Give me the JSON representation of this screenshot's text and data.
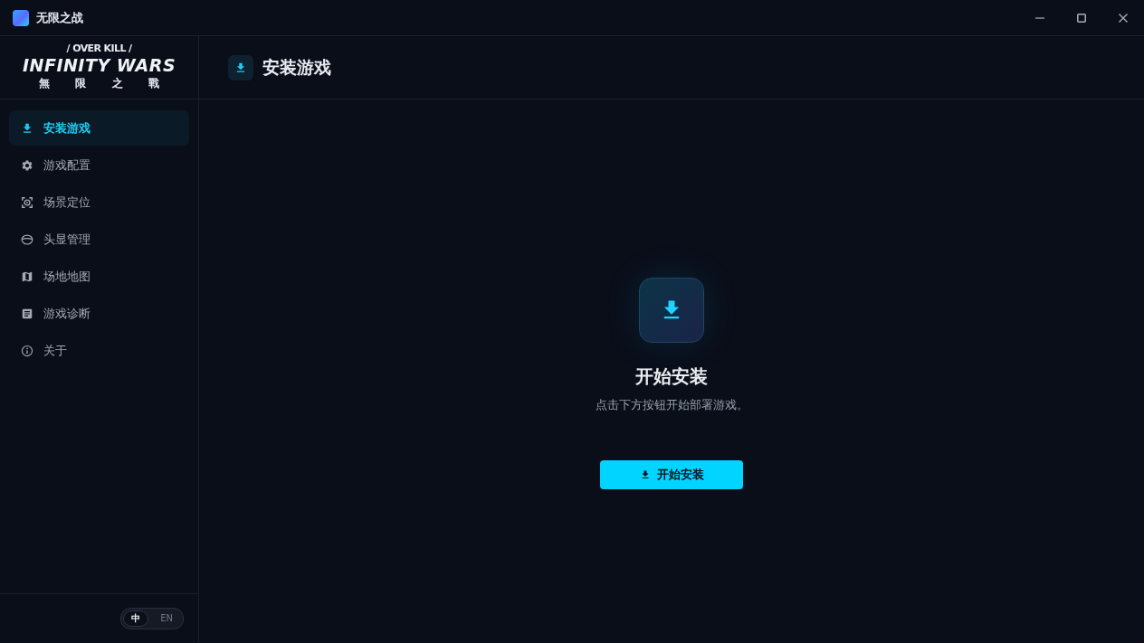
{
  "window": {
    "title": "无限之战"
  },
  "logo": {
    "tagline": "/ OVER KILL /",
    "name": "INFINITY WARS",
    "subtitle": "無 限 之 戰"
  },
  "sidebar": {
    "items": [
      {
        "label": "安装游戏",
        "selected": true
      },
      {
        "label": "游戏配置",
        "selected": false
      },
      {
        "label": "场景定位",
        "selected": false
      },
      {
        "label": "头显管理",
        "selected": false
      },
      {
        "label": "场地地图",
        "selected": false
      },
      {
        "label": "游戏诊断",
        "selected": false
      },
      {
        "label": "关于",
        "selected": false
      }
    ]
  },
  "language_toggle": {
    "options": [
      {
        "label": "中",
        "selected": true
      },
      {
        "label": "EN",
        "selected": false
      }
    ]
  },
  "header": {
    "title": "安装游戏"
  },
  "install_panel": {
    "title": "开始安装",
    "description": "点击下方按钮开始部署游戏。",
    "button": "开始安装"
  }
}
